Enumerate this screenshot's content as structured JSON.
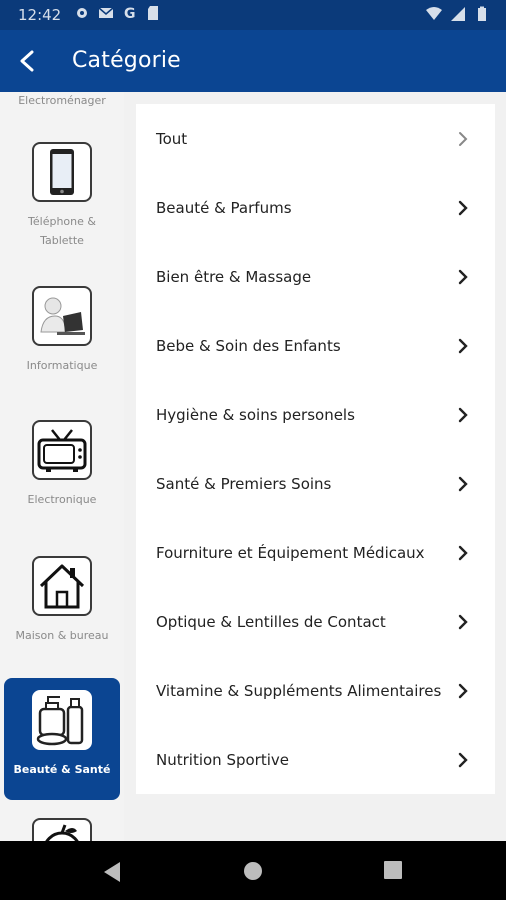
{
  "status_bar": {
    "time": "12:42",
    "icons_left": [
      "gear-icon",
      "mail-icon",
      "google-icon",
      "sd-card-icon"
    ],
    "icons_right": [
      "wifi-icon",
      "signal-icon",
      "battery-icon"
    ]
  },
  "app_bar": {
    "title": "Catégorie",
    "back_icon": "back-arrow-icon"
  },
  "sidebar": {
    "top_partial_label": "Electroménager",
    "items": [
      {
        "label": "Téléphone & Tablette",
        "icon": "phone-icon",
        "active": false
      },
      {
        "label": "Informatique",
        "icon": "computer-user-icon",
        "active": false
      },
      {
        "label": "Electronique",
        "icon": "tv-icon",
        "active": false
      },
      {
        "label": "Maison & bureau",
        "icon": "house-icon",
        "active": false
      },
      {
        "label": "Beauté & Santé",
        "icon": "beauty-products-icon",
        "active": true
      },
      {
        "label": "",
        "icon": "fruit-icon",
        "active": false
      }
    ]
  },
  "subcategories": [
    {
      "label": "Tout"
    },
    {
      "label": "Beauté & Parfums"
    },
    {
      "label": "Bien être & Massage"
    },
    {
      "label": "Bebe & Soin des Enfants"
    },
    {
      "label": "Hygiène & soins personels"
    },
    {
      "label": "Santé & Premiers Soins"
    },
    {
      "label": "Fourniture et Équipement Médicaux"
    },
    {
      "label": "Optique & Lentilles de Contact"
    },
    {
      "label": "Vitamine & Suppléments Alimentaires"
    },
    {
      "label": "Nutrition Sportive"
    }
  ],
  "colors": {
    "primary": "#0b4592",
    "status_bar": "#0b3a7a",
    "sidebar_bg": "#f3f3f3",
    "panel_bg": "#ffffff",
    "active_text": "#ffffff",
    "muted_text": "#8a8a8a"
  },
  "nav_bar": {
    "icons": [
      "nav-back-icon",
      "nav-home-icon",
      "nav-recents-icon"
    ]
  }
}
